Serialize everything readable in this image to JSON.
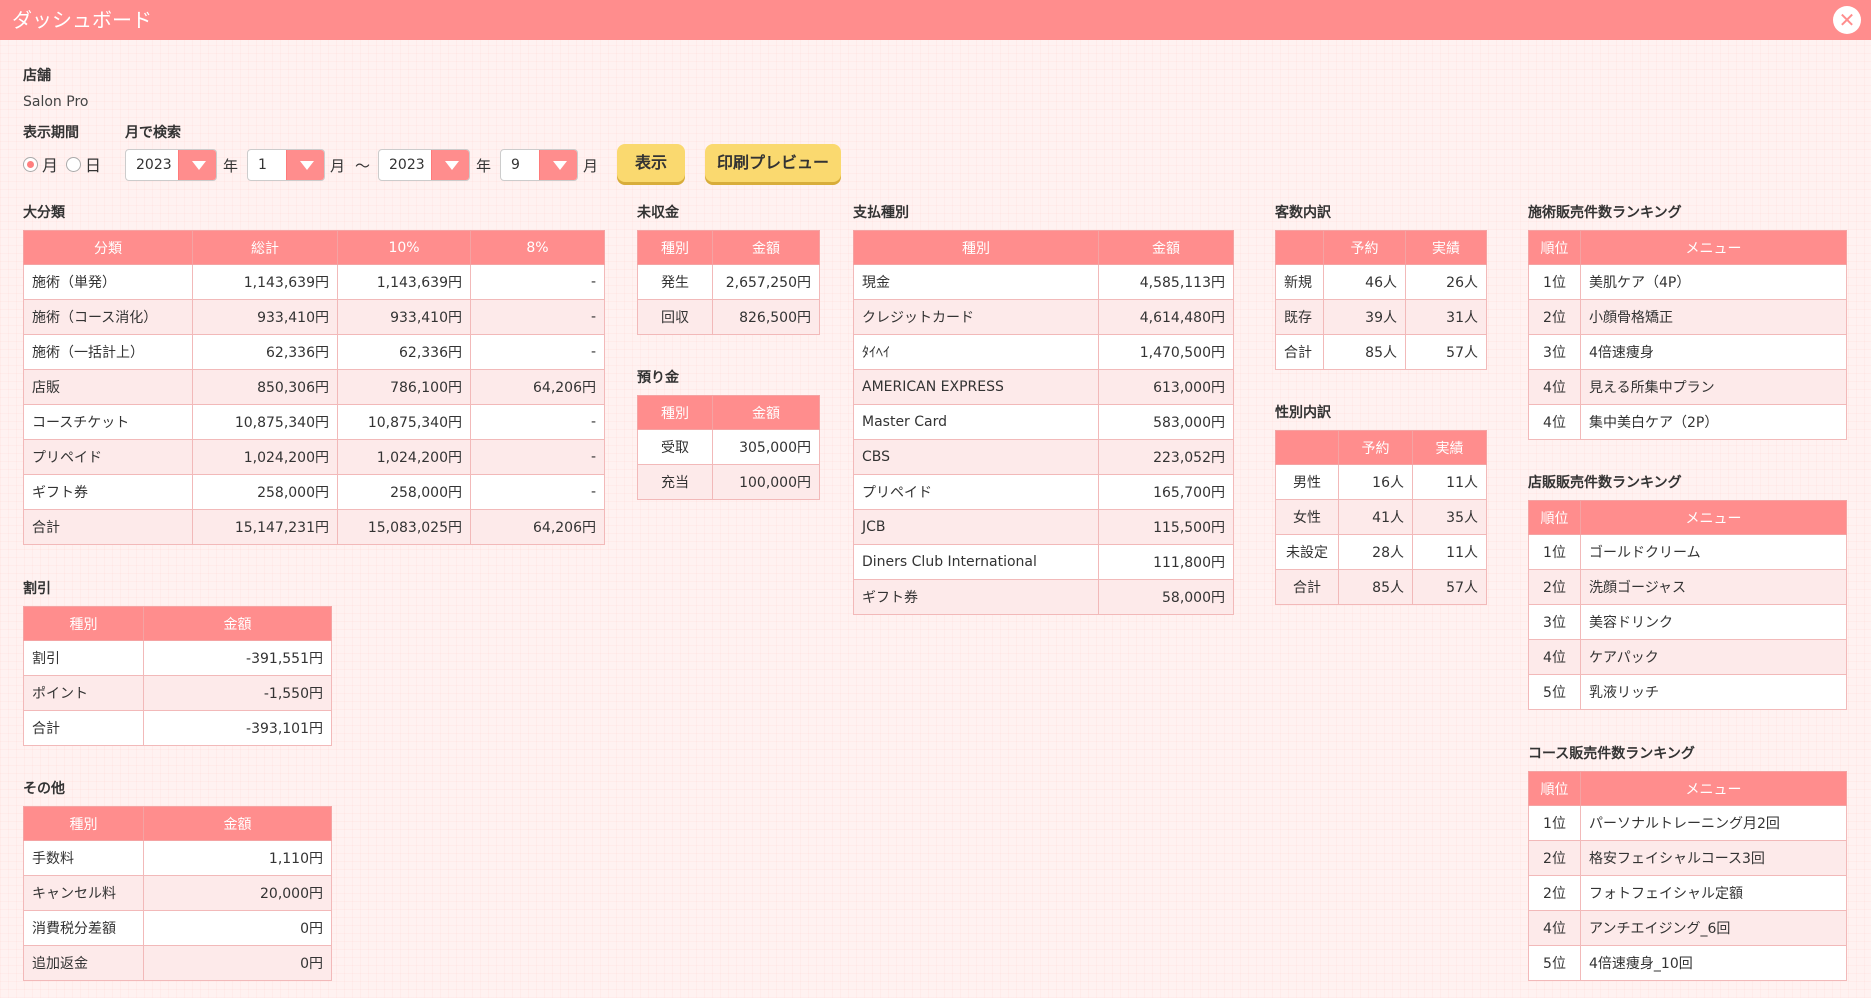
{
  "title": "ダッシュボード",
  "store": {
    "label": "店舗",
    "value": "Salon Pro"
  },
  "period": {
    "label": "表示期間",
    "search_label": "月で検索",
    "radio_month": "月",
    "radio_day": "日",
    "from_year": "2023",
    "from_month": "1",
    "to_year": "2023",
    "to_month": "9",
    "year_unit": "年",
    "month_unit": "月",
    "tilde": "〜"
  },
  "buttons": {
    "show": "表示",
    "print": "印刷プレビュー"
  },
  "major": {
    "title": "大分類",
    "headers": [
      "分類",
      "総計",
      "10%",
      "8%"
    ],
    "rows": [
      [
        "施術（単発）",
        "1,143,639円",
        "1,143,639円",
        "-"
      ],
      [
        "施術（コース消化）",
        "933,410円",
        "933,410円",
        "-"
      ],
      [
        "施術（一括計上）",
        "62,336円",
        "62,336円",
        "-"
      ],
      [
        "店販",
        "850,306円",
        "786,100円",
        "64,206円"
      ],
      [
        "コースチケット",
        "10,875,340円",
        "10,875,340円",
        "-"
      ],
      [
        "プリペイド",
        "1,024,200円",
        "1,024,200円",
        "-"
      ],
      [
        "ギフト券",
        "258,000円",
        "258,000円",
        "-"
      ],
      [
        "合計",
        "15,147,231円",
        "15,083,025円",
        "64,206円"
      ]
    ]
  },
  "discount": {
    "title": "割引",
    "headers": [
      "種別",
      "金額"
    ],
    "rows": [
      [
        "割引",
        "-391,551円"
      ],
      [
        "ポイント",
        "-1,550円"
      ],
      [
        "合計",
        "-393,101円"
      ]
    ]
  },
  "other": {
    "title": "その他",
    "headers": [
      "種別",
      "金額"
    ],
    "rows": [
      [
        "手数料",
        "1,110円"
      ],
      [
        "キャンセル料",
        "20,000円"
      ],
      [
        "消費税分差額",
        "0円"
      ],
      [
        "追加返金",
        "0円"
      ]
    ]
  },
  "unpaid": {
    "title": "未収金",
    "headers": [
      "種別",
      "金額"
    ],
    "rows": [
      [
        "発生",
        "2,657,250円"
      ],
      [
        "回収",
        "826,500円"
      ]
    ]
  },
  "deposit": {
    "title": "預り金",
    "headers": [
      "種別",
      "金額"
    ],
    "rows": [
      [
        "受取",
        "305,000円"
      ],
      [
        "充当",
        "100,000円"
      ]
    ]
  },
  "payment": {
    "title": "支払種別",
    "headers": [
      "種別",
      "金額"
    ],
    "rows": [
      [
        "現金",
        "4,585,113円"
      ],
      [
        "クレジットカード",
        "4,614,480円"
      ],
      [
        "ﾀｲﾍｲ",
        "1,470,500円"
      ],
      [
        "AMERICAN EXPRESS",
        "613,000円"
      ],
      [
        "Master Card",
        "583,000円"
      ],
      [
        "CBS",
        "223,052円"
      ],
      [
        "プリペイド",
        "165,700円"
      ],
      [
        "JCB",
        "115,500円"
      ],
      [
        "Diners Club International",
        "111,800円"
      ],
      [
        "ギフト券",
        "58,000円"
      ]
    ]
  },
  "customers": {
    "title": "客数内訳",
    "headers": [
      "",
      "予約",
      "実績"
    ],
    "rows": [
      [
        "新規",
        "46人",
        "26人"
      ],
      [
        "既存",
        "39人",
        "31人"
      ],
      [
        "合計",
        "85人",
        "57人"
      ]
    ]
  },
  "gender": {
    "title": "性別内訳",
    "headers": [
      "",
      "予約",
      "実績"
    ],
    "rows": [
      [
        "男性",
        "16人",
        "11人"
      ],
      [
        "女性",
        "41人",
        "35人"
      ],
      [
        "未設定",
        "28人",
        "11人"
      ],
      [
        "合計",
        "85人",
        "57人"
      ]
    ]
  },
  "treatment_rank": {
    "title": "施術販売件数ランキング",
    "headers": [
      "順位",
      "メニュー"
    ],
    "rows": [
      [
        "1位",
        "美肌ケア（4P）"
      ],
      [
        "2位",
        "小顔骨格矯正"
      ],
      [
        "3位",
        "4倍速痩身"
      ],
      [
        "4位",
        "見える所集中プラン"
      ],
      [
        "4位",
        "集中美白ケア（2P）"
      ]
    ]
  },
  "retail_rank": {
    "title": "店販販売件数ランキング",
    "headers": [
      "順位",
      "メニュー"
    ],
    "rows": [
      [
        "1位",
        "ゴールドクリーム"
      ],
      [
        "2位",
        "洗顔ゴージャス"
      ],
      [
        "3位",
        "美容ドリンク"
      ],
      [
        "4位",
        "ケアパック"
      ],
      [
        "5位",
        "乳液リッチ"
      ]
    ]
  },
  "course_rank": {
    "title": "コース販売件数ランキング",
    "headers": [
      "順位",
      "メニュー"
    ],
    "rows": [
      [
        "1位",
        "パーソナルトレーニング月2回"
      ],
      [
        "2位",
        "格安フェイシャルコース3回"
      ],
      [
        "2位",
        "フォトフェイシャル定額"
      ],
      [
        "4位",
        "アンチエイジング_6回"
      ],
      [
        "5位",
        "4倍速痩身_10回"
      ]
    ]
  }
}
